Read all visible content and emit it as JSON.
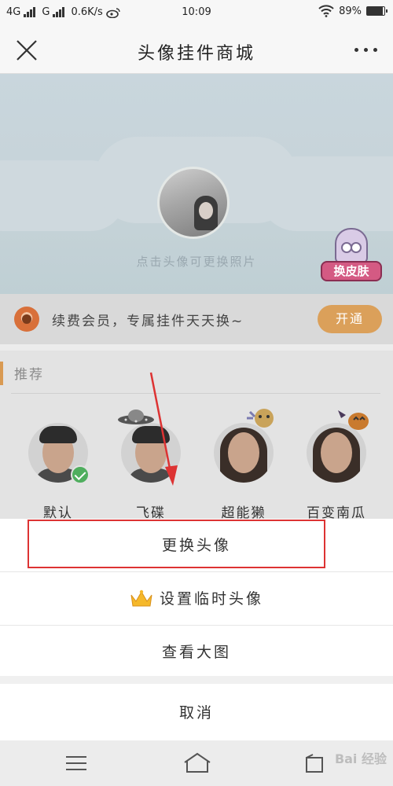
{
  "status_bar": {
    "net1": "4G",
    "net2": "G",
    "speed": "0.6K/s",
    "time": "10:09",
    "battery": "89%",
    "battery_level": 0.89
  },
  "header": {
    "title": "头像挂件商城"
  },
  "banner": {
    "hint": "点击头像可更换照片",
    "skin_label": "换皮肤"
  },
  "vip": {
    "text": "续费会员，专属挂件天天换~",
    "button": "开通"
  },
  "recommend": {
    "title": "推荐",
    "items": [
      {
        "label": "默认",
        "icon": "check-icon"
      },
      {
        "label": "飞碟",
        "icon": "ufo-icon"
      },
      {
        "label": "超能獭",
        "icon": "deco-icon"
      },
      {
        "label": "百变南瓜",
        "icon": "pumpkin-icon"
      }
    ]
  },
  "sheet": {
    "items": [
      {
        "label": "更换头像"
      },
      {
        "label": "设置临时头像",
        "icon": "crown-icon"
      },
      {
        "label": "查看大图"
      }
    ],
    "cancel": "取消"
  },
  "watermark": "Bai 经验",
  "colors": {
    "accent": "#dba05a",
    "check": "#4fae5e",
    "highlight": "#dd3333"
  }
}
